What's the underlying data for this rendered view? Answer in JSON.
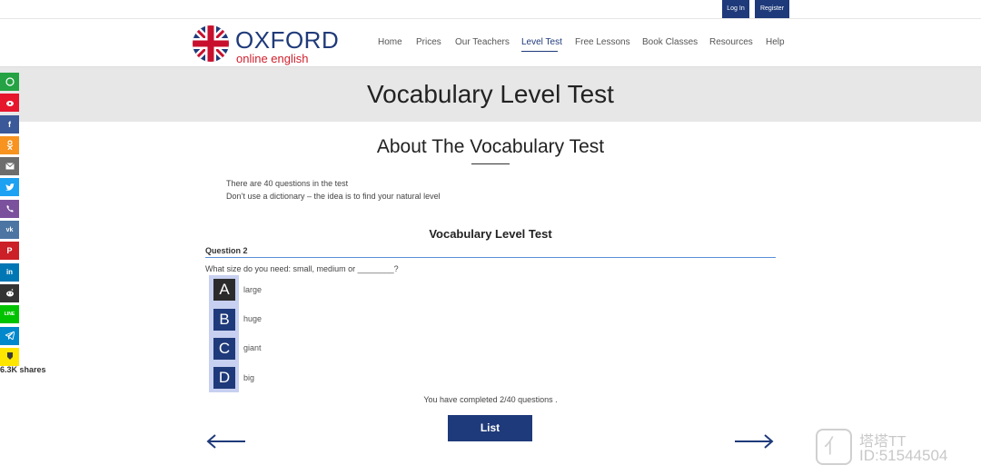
{
  "topbar": {
    "login_label": "Log In",
    "register_label": "Register"
  },
  "logo": {
    "title": "OXFORD",
    "subtitle": "online english"
  },
  "nav": {
    "items": [
      {
        "label": "Home"
      },
      {
        "label": "Prices"
      },
      {
        "label": "Our Teachers"
      },
      {
        "label": "Level Test",
        "active": true
      },
      {
        "label": "Free Lessons"
      },
      {
        "label": "Book Classes"
      },
      {
        "label": "Resources"
      },
      {
        "label": "Help"
      }
    ]
  },
  "banner": {
    "title": "Vocabulary Level Test"
  },
  "share": {
    "buttons": [
      {
        "icon": "whatsapp-icon",
        "color": "#25a244"
      },
      {
        "icon": "weibo-icon",
        "color": "#e6162d"
      },
      {
        "icon": "facebook-icon",
        "color": "#3b5998"
      },
      {
        "icon": "odnoklassniki-icon",
        "color": "#f7931e"
      },
      {
        "icon": "email-icon",
        "color": "#6d6d6d"
      },
      {
        "icon": "twitter-icon",
        "color": "#1da1f2"
      },
      {
        "icon": "viber-icon",
        "color": "#7b519d"
      },
      {
        "icon": "vk-icon",
        "color": "#4c75a3"
      },
      {
        "icon": "pinterest-icon",
        "color": "#cb2027"
      },
      {
        "icon": "linkedin-icon",
        "color": "#0077b5"
      },
      {
        "icon": "reddit-icon",
        "color": "#333333"
      },
      {
        "icon": "line-icon",
        "color": "#00c300"
      },
      {
        "icon": "telegram-icon",
        "color": "#0088cc"
      },
      {
        "icon": "bulb-icon",
        "color": "#ffe600"
      }
    ],
    "count": "6.3K shares"
  },
  "about": {
    "title": "About The Vocabulary Test",
    "line1": "There are 40 questions in the test",
    "line2": "Don’t use a dictionary – the idea is to find your natural level"
  },
  "quiz": {
    "title": "Vocabulary Level Test",
    "question_label": "Question 2",
    "question_text": "What size do you need: small, medium or ________?",
    "options": [
      {
        "letter": "A",
        "text": "large",
        "selected": true
      },
      {
        "letter": "B",
        "text": "huge"
      },
      {
        "letter": "C",
        "text": "giant"
      },
      {
        "letter": "D",
        "text": "big"
      }
    ],
    "progress_text": "You have completed 2/40 questions .",
    "list_label": "List"
  },
  "watermark": {
    "line1": "塔塔TT",
    "line2": "ID:51544504"
  },
  "colors": {
    "brand": "#1f3a7a",
    "accent_red": "#d0202e",
    "banner_bg": "#e7e7e7"
  }
}
